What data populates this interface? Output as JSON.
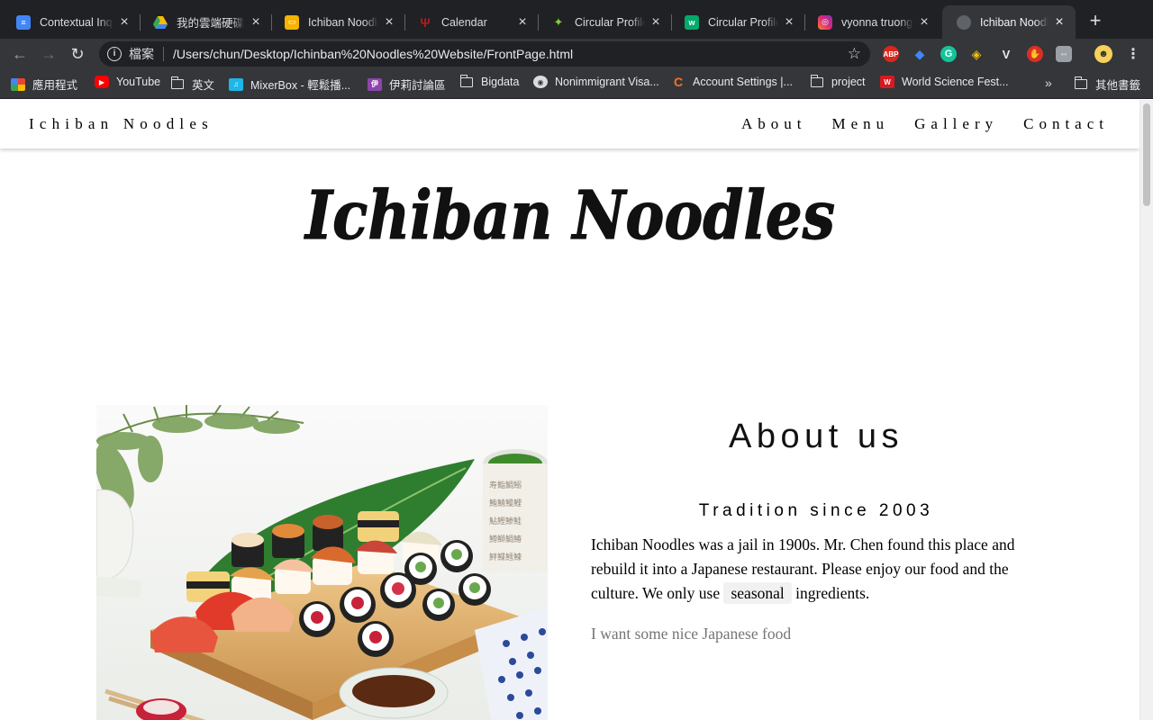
{
  "tabs": [
    {
      "title": "Contextual Inquiry",
      "icon": "google-docs-icon",
      "color": "#4285f4"
    },
    {
      "title": "我的雲端硬碟 - Google",
      "icon": "google-drive-icon",
      "color": "#fbbc04"
    },
    {
      "title": "Ichiban Noodles",
      "icon": "google-slides-icon",
      "color": "#f4b400"
    },
    {
      "title": "Calendar",
      "icon": "calendar-icon",
      "color": "#b31b1b"
    },
    {
      "title": "Circular Profile Picture",
      "icon": "codepen-icon",
      "color": "#7bd23f"
    },
    {
      "title": "Circular Profile Picture",
      "icon": "w3schools-icon",
      "color": "#04aa6d"
    },
    {
      "title": "vyonna truong",
      "icon": "instagram-icon",
      "color": "#e1306c"
    },
    {
      "title": "Ichiban Noodles",
      "icon": "globe-icon",
      "color": "#5f6368"
    }
  ],
  "address": {
    "scheme_label": "檔案",
    "url": "/Users/chun/Desktop/Ichinban%20Noodles%20Website/FrontPage.html"
  },
  "bookmarks": [
    {
      "label": "應用程式",
      "icon": "apps-grid-icon"
    },
    {
      "label": "YouTube",
      "icon": "youtube-icon"
    },
    {
      "label": "英文",
      "icon": "folder-icon"
    },
    {
      "label": "MixerBox - 輕鬆播...",
      "icon": "mixerbox-icon"
    },
    {
      "label": "伊莉討論區",
      "icon": "eyny-icon"
    },
    {
      "label": "Bigdata",
      "icon": "folder-icon"
    },
    {
      "label": "Nonimmigrant Visa...",
      "icon": "globe-icon"
    },
    {
      "label": "Account Settings |...",
      "icon": "crunchyroll-icon"
    },
    {
      "label": "project",
      "icon": "folder-icon"
    },
    {
      "label": "World Science Fest...",
      "icon": "wsf-icon"
    },
    {
      "label": "其他書籤",
      "icon": "folder-icon"
    }
  ],
  "site": {
    "brand": "Ichiban Noodles",
    "nav": [
      "About",
      "Menu",
      "Gallery",
      "Contact"
    ],
    "logo_text": "Ichiban Noodles"
  },
  "about": {
    "heading": "About us",
    "subheading": "Tradition since 2003",
    "body_before": "Ichiban Noodles was a jail in 1900s. Mr. Chen found this place and rebuild it into a Japanese restaurant. Please enjoy our food and the culture. We only use",
    "highlight": "seasonal",
    "body_after": "ingredients.",
    "quote": "I want some nice Japanese food"
  },
  "extensions": [
    "adblock-plus-icon",
    "bookmark-manager-icon",
    "grammarly-icon",
    "keeper-icon",
    "vimium-icon",
    "stop-hand-icon",
    "line-icon",
    "profile-avatar-icon"
  ]
}
